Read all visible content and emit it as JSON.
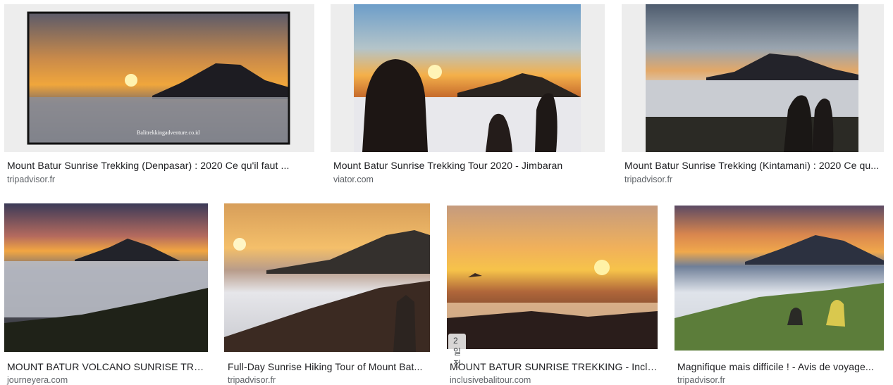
{
  "results": [
    {
      "title": "Mount Batur Sunrise Trekking (Denpasar) : 2020 Ce qu'il faut ...",
      "source": "tripadvisor.fr",
      "watermark": "Balitrekkingadventure.co.id"
    },
    {
      "title": "Mount Batur Sunrise Trekking Tour 2020 - Jimbaran",
      "source": "viator.com"
    },
    {
      "title": "Mount Batur Sunrise Trekking (Kintamani) : 2020 Ce qu...",
      "source": "tripadvisor.fr"
    },
    {
      "title": "MOUNT BATUR VOLCANO SUNRISE TREK ...",
      "source": "journeyera.com"
    },
    {
      "title": "Full-Day Sunrise Hiking Tour of Mount Bat...",
      "source": "tripadvisor.fr"
    },
    {
      "title": "MOUNT BATUR SUNRISE TREKKING - Inclus...",
      "source": "inclusivebalitour.com",
      "badge": "2일 전"
    },
    {
      "title": "Magnifique mais difficile ! - Avis de voyage...",
      "source": "tripadvisor.fr"
    }
  ]
}
